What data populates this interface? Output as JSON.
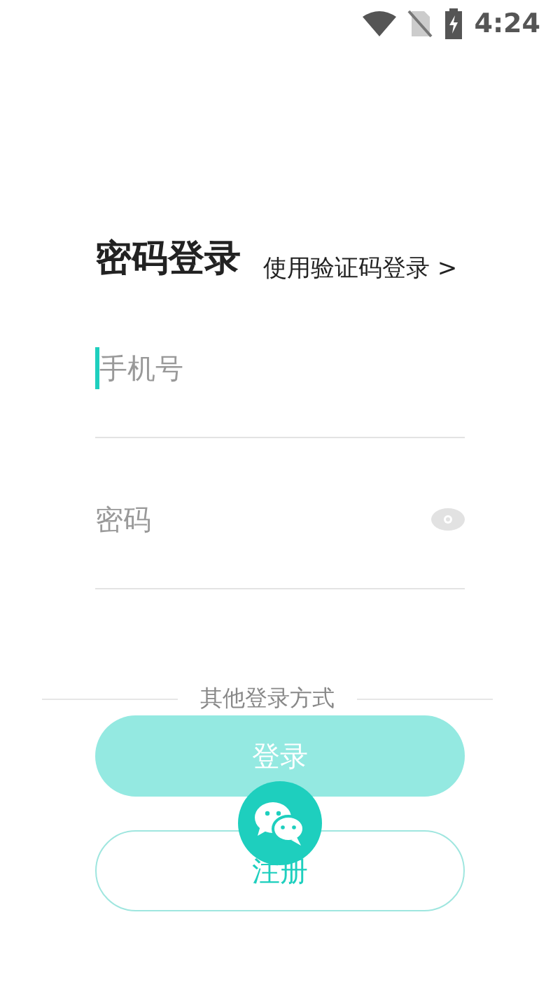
{
  "status_bar": {
    "time": "4:24"
  },
  "title": "密码登录",
  "switch_link": {
    "label": "使用验证码登录",
    "arrow": ">"
  },
  "fields": [
    {
      "kind": "phone",
      "placeholder": "手机号",
      "focused": true
    },
    {
      "kind": "password",
      "placeholder": "密码",
      "focused": false
    }
  ],
  "divider_label": "其他登录方式",
  "login_button": {
    "label": "登录",
    "disabled": true
  },
  "register_button": {
    "label": "注册"
  }
}
